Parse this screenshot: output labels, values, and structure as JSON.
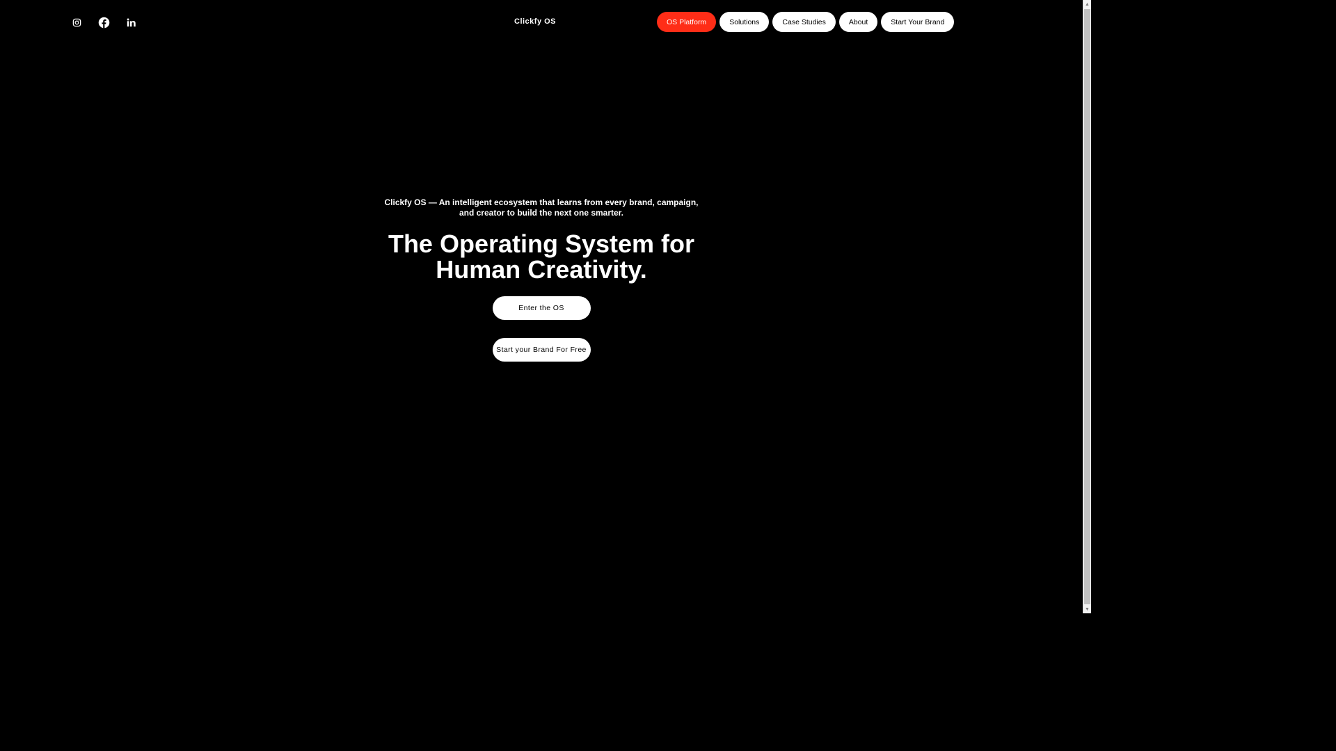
{
  "header": {
    "social": [
      {
        "icon": "instagram-icon"
      },
      {
        "icon": "facebook-icon"
      },
      {
        "icon": "linkedin-icon"
      }
    ],
    "brand": "Clickfy OS",
    "nav": [
      {
        "label": "OS Platform",
        "active": true
      },
      {
        "label": "Solutions",
        "active": false
      },
      {
        "label": "Case Studies",
        "active": false
      },
      {
        "label": "About",
        "active": false
      },
      {
        "label": "Start Your Brand",
        "active": false
      }
    ]
  },
  "hero": {
    "tagline": "Clickfy OS — An intelligent ecosystem that learns from every brand, campaign, and creator to build the next one smarter.",
    "headline": "The Operating System for Human Creativity.",
    "primary_cta": "Enter the OS",
    "secondary_cta": "Start your Brand For Free"
  },
  "colors": {
    "background": "#000000",
    "accent": "#ff2d17",
    "pill": "#ffffff"
  },
  "scrollbar": {
    "up_arrow": "▲",
    "down_arrow": "▼"
  }
}
